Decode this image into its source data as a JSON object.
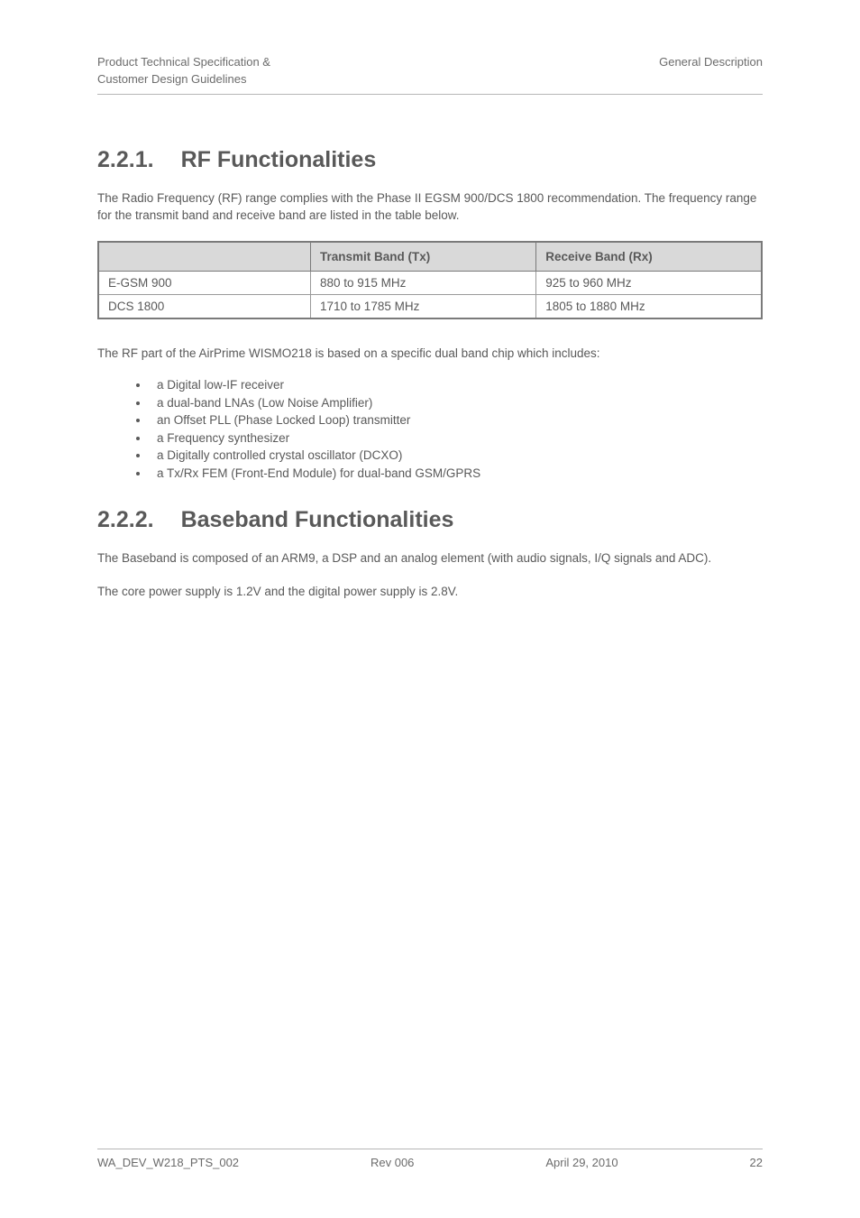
{
  "header": {
    "left_line1": "Product Technical Specification &",
    "left_line2": "Customer Design Guidelines",
    "right": "General Description"
  },
  "section221": {
    "number": "2.2.1.",
    "title": "RF Functionalities",
    "intro_line1": "The Radio Frequency (RF) range complies with the Phase II EGSM 900/DCS 1800 recommendation.",
    "intro_line2": "The frequency range for the transmit band and receive band are listed in the table below.",
    "table_head_col1": "",
    "table_head_tx": "Transmit Band (Tx)",
    "table_head_rx": "Receive Band (Rx)",
    "rows": [
      {
        "name": "E-GSM 900",
        "tx": "880 to 915 MHz",
        "rx": "925 to 960 MHz"
      },
      {
        "name": "DCS 1800",
        "tx": "1710 to 1785 MHz",
        "rx": "1805 to 1880 MHz"
      }
    ],
    "after_table": "The RF part of the AirPrime WISMO218 is based on a specific dual band chip which includes:",
    "bullets": [
      "a Digital low-IF receiver",
      "a dual-band LNAs (Low Noise Amplifier)",
      "an Offset PLL (Phase Locked Loop) transmitter",
      "a Frequency synthesizer",
      "a Digitally controlled crystal oscillator (DCXO)",
      "a Tx/Rx FEM (Front-End Module) for dual-band GSM/GPRS"
    ]
  },
  "section222": {
    "number": "2.2.2.",
    "title": "Baseband Functionalities",
    "para1": "The Baseband is composed of an ARM9, a DSP and an analog element (with audio signals, I/Q signals and ADC).",
    "para2": "The core power supply is 1.2V and the digital power supply is 2.8V."
  },
  "footer": {
    "doc_id": "WA_DEV_W218_PTS_002",
    "rev": "Rev 006",
    "date": "April 29, 2010",
    "page": "22"
  }
}
